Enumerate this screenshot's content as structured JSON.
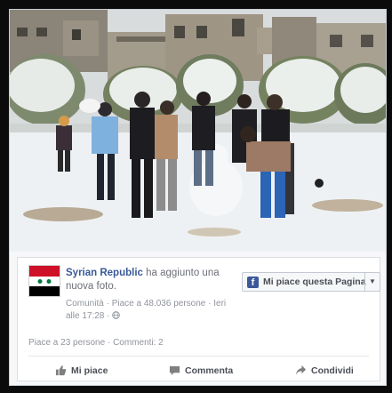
{
  "post": {
    "page_name": "Syrian Republic",
    "action_text": " ha aggiunto una nuova foto.",
    "category": "Comunità",
    "likes_count": "Piace a 48.036 persone",
    "timestamp": "Ieri alle 17:28",
    "privacy_icon": "globe-icon",
    "separator": " · "
  },
  "like_page_button": {
    "icon": "facebook-f-icon",
    "label": "Mi piace questa Pagina",
    "caret_icon": "chevron-down-icon"
  },
  "stats": {
    "likes": "Piace a 23 persone",
    "separator": " · ",
    "comments": "Commenti: 2"
  },
  "actions": [
    {
      "label": "Mi piace",
      "icon": "thumbs-up-icon"
    },
    {
      "label": "Commenta",
      "icon": "comment-icon"
    },
    {
      "label": "Condividi",
      "icon": "share-icon"
    }
  ],
  "colors": {
    "brand": "#3b5998",
    "meta_text": "#90949c",
    "action_text": "#4b4f56"
  },
  "photo": {
    "description_icon": "snow-scene-photo"
  }
}
